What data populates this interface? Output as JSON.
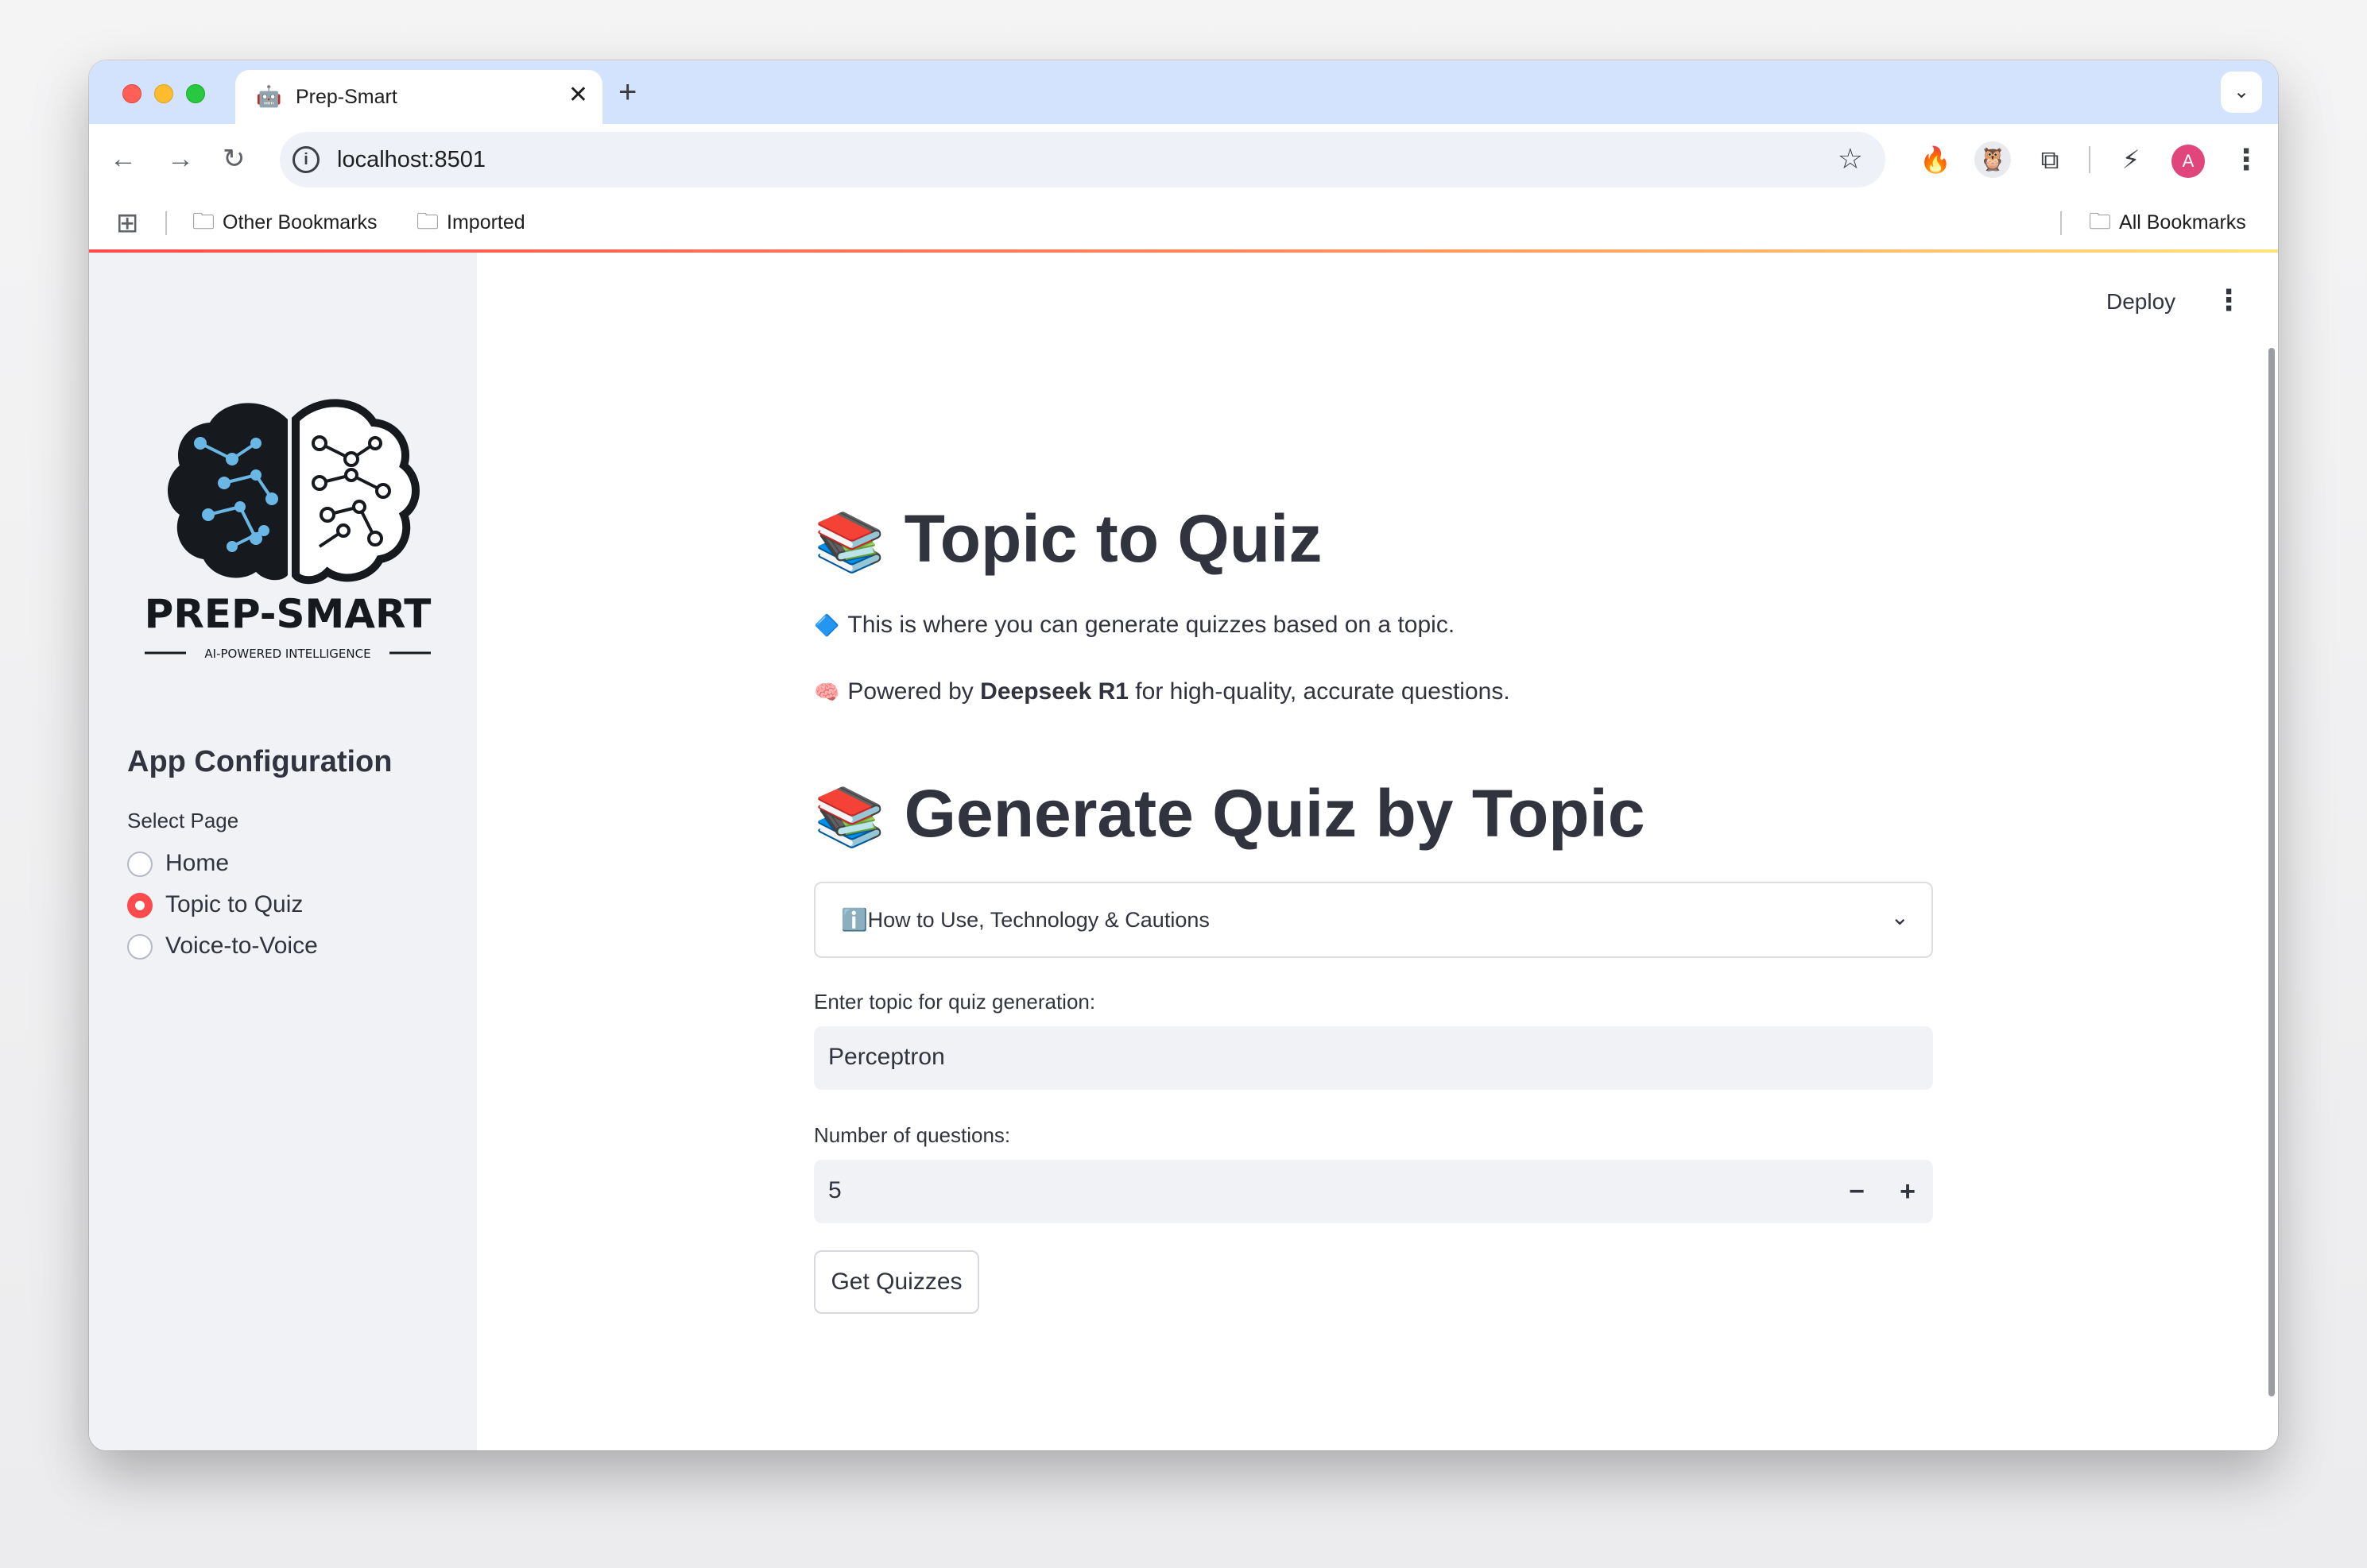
{
  "browser": {
    "tab_title": "Prep-Smart",
    "tab_favicon": "🤖",
    "url": "localhost:8501",
    "profile_initial": "A",
    "bookmarks": {
      "other": "Other Bookmarks",
      "imported": "Imported",
      "all": "All Bookmarks"
    }
  },
  "app": {
    "deploy_label": "Deploy",
    "sidebar": {
      "logo_title": "PREP-SMART",
      "logo_tagline": "AI-POWERED INTELLIGENCE",
      "heading": "App Configuration",
      "select_label": "Select Page",
      "pages": [
        {
          "label": "Home",
          "selected": false
        },
        {
          "label": "Topic to Quiz",
          "selected": true
        },
        {
          "label": "Voice-to-Voice",
          "selected": false
        }
      ]
    },
    "main": {
      "title_emoji": "📚",
      "title": "Topic to Quiz",
      "intro_emoji": "🔷",
      "intro": "This is where you can generate quizzes based on a topic.",
      "powered_emoji": "🧠",
      "powered_prefix": "Powered by",
      "powered_model": "Deepseek R1",
      "powered_suffix": "for high-quality, accurate questions.",
      "section_emoji": "📚",
      "section_title": "Generate Quiz by Topic",
      "expander_icon": "ℹ️",
      "expander_label": "How to Use, Technology & Cautions",
      "topic_label": "Enter topic for quiz generation:",
      "topic_value": "Perceptron",
      "num_label": "Number of questions:",
      "num_value": "5",
      "submit_label": "Get Quizzes"
    }
  },
  "colors": {
    "accent": "#ff4b4b",
    "text": "#31333f",
    "sidebar_bg": "#f0f2f6",
    "tabstrip_bg": "#d3e3fd"
  }
}
